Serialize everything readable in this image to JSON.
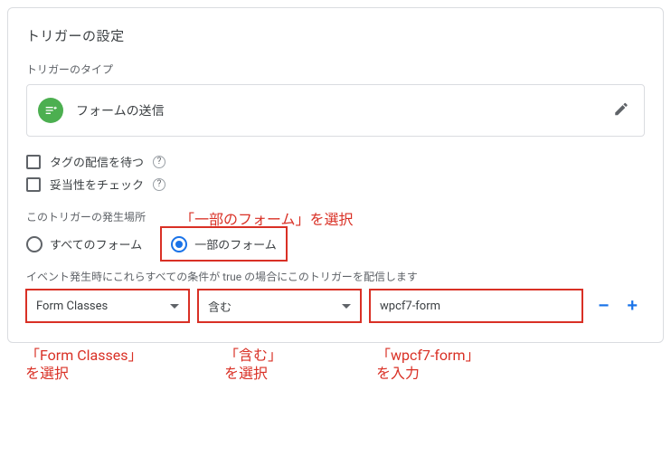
{
  "title": "トリガーの設定",
  "trigger_type": {
    "section_label": "トリガーのタイプ",
    "name": "フォームの送信"
  },
  "options": {
    "wait_for_tags": "タグの配信を待つ",
    "check_validation": "妥当性をチェック"
  },
  "fires_on": {
    "section_label": "このトリガーの発生場所",
    "all_forms": "すべてのフォーム",
    "some_forms": "一部のフォーム"
  },
  "condition": {
    "desc": "イベント発生時にこれらすべての条件が true の場合にこのトリガーを配信します",
    "variable": "Form Classes",
    "operator": "含む",
    "value": "wpcf7-form"
  },
  "annotations": {
    "some_forms": "「一部のフォーム」を選択",
    "form_classes": "「Form Classes」\nを選択",
    "operator": "「含む」\nを選択",
    "value": "「wpcf7-form」\nを入力"
  }
}
